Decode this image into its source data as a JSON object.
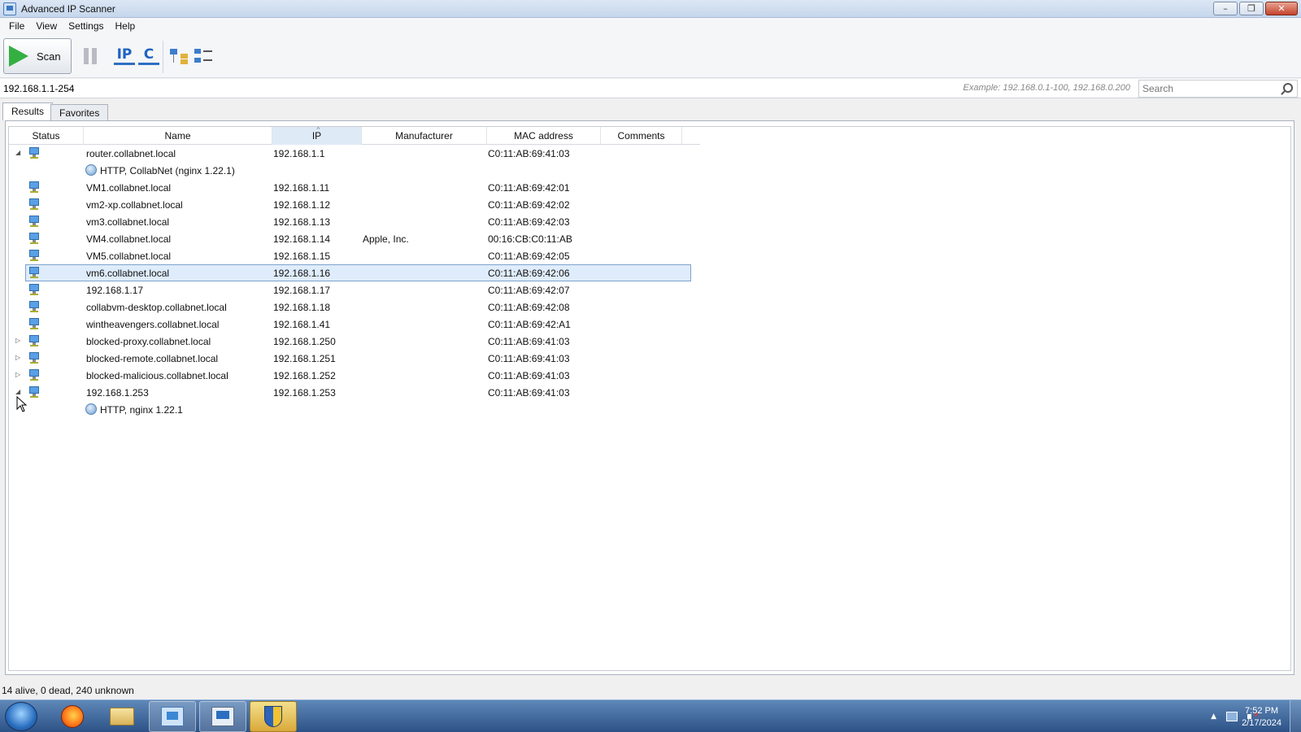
{
  "window": {
    "title": "Advanced IP Scanner",
    "controls": [
      "–",
      "❐",
      "✕"
    ]
  },
  "menu": [
    "File",
    "View",
    "Settings",
    "Help"
  ],
  "toolbar": {
    "scan_label": "Scan",
    "ip_label": "IP",
    "c_label": "C"
  },
  "address": {
    "range": "192.168.1.1-254",
    "example": "Example: 192.168.0.1-100, 192.168.0.200",
    "search_placeholder": "Search"
  },
  "tabs": [
    {
      "label": "Results",
      "active": true
    },
    {
      "label": "Favorites",
      "active": false
    }
  ],
  "columns": [
    "Status",
    "Name",
    "IP",
    "Manufacturer",
    "MAC address",
    "Comments"
  ],
  "rows": [
    {
      "type": "host",
      "expander": "collapse",
      "name": "router.collabnet.local",
      "ip": "192.168.1.1",
      "manufacturer": "",
      "mac": "C0:11:AB:69:41:03"
    },
    {
      "type": "service",
      "label": "HTTP, CollabNet (nginx 1.22.1)"
    },
    {
      "type": "host",
      "expander": "",
      "name": "VM1.collabnet.local",
      "ip": "192.168.1.11",
      "manufacturer": "",
      "mac": "C0:11:AB:69:42:01"
    },
    {
      "type": "host",
      "expander": "",
      "name": "vm2-xp.collabnet.local",
      "ip": "192.168.1.12",
      "manufacturer": "",
      "mac": "C0:11:AB:69:42:02"
    },
    {
      "type": "host",
      "expander": "",
      "name": "vm3.collabnet.local",
      "ip": "192.168.1.13",
      "manufacturer": "",
      "mac": "C0:11:AB:69:42:03"
    },
    {
      "type": "host",
      "expander": "",
      "name": "VM4.collabnet.local",
      "ip": "192.168.1.14",
      "manufacturer": "Apple, Inc.",
      "mac": "00:16:CB:C0:11:AB"
    },
    {
      "type": "host",
      "expander": "",
      "name": "VM5.collabnet.local",
      "ip": "192.168.1.15",
      "manufacturer": "",
      "mac": "C0:11:AB:69:42:05"
    },
    {
      "type": "host",
      "expander": "",
      "selected": true,
      "name": "vm6.collabnet.local",
      "ip": "192.168.1.16",
      "manufacturer": "",
      "mac": "C0:11:AB:69:42:06"
    },
    {
      "type": "host",
      "expander": "",
      "name": "192.168.1.17",
      "ip": "192.168.1.17",
      "manufacturer": "",
      "mac": "C0:11:AB:69:42:07"
    },
    {
      "type": "host",
      "expander": "",
      "name": "collabvm-desktop.collabnet.local",
      "ip": "192.168.1.18",
      "manufacturer": "",
      "mac": "C0:11:AB:69:42:08"
    },
    {
      "type": "host",
      "expander": "",
      "name": "wintheavengers.collabnet.local",
      "ip": "192.168.1.41",
      "manufacturer": "",
      "mac": "C0:11:AB:69:42:A1"
    },
    {
      "type": "host",
      "expander": "expand",
      "name": "blocked-proxy.collabnet.local",
      "ip": "192.168.1.250",
      "manufacturer": "",
      "mac": "C0:11:AB:69:41:03"
    },
    {
      "type": "host",
      "expander": "expand",
      "name": "blocked-remote.collabnet.local",
      "ip": "192.168.1.251",
      "manufacturer": "",
      "mac": "C0:11:AB:69:41:03"
    },
    {
      "type": "host",
      "expander": "expand",
      "name": "blocked-malicious.collabnet.local",
      "ip": "192.168.1.252",
      "manufacturer": "",
      "mac": "C0:11:AB:69:41:03"
    },
    {
      "type": "host",
      "expander": "collapse",
      "name": "192.168.1.253",
      "ip": "192.168.1.253",
      "manufacturer": "",
      "mac": "C0:11:AB:69:41:03"
    },
    {
      "type": "service",
      "label": "HTTP, nginx 1.22.1"
    }
  ],
  "status": "14 alive, 0 dead, 240 unknown",
  "taskbar": {
    "time": "7:52 PM",
    "date": "2/17/2024",
    "tray_up": "▲"
  },
  "colors": {
    "selection": "#dfecfb",
    "selection_border": "#7da2ce",
    "scan_green": "#34b042",
    "taskbar": "#2c5287"
  }
}
